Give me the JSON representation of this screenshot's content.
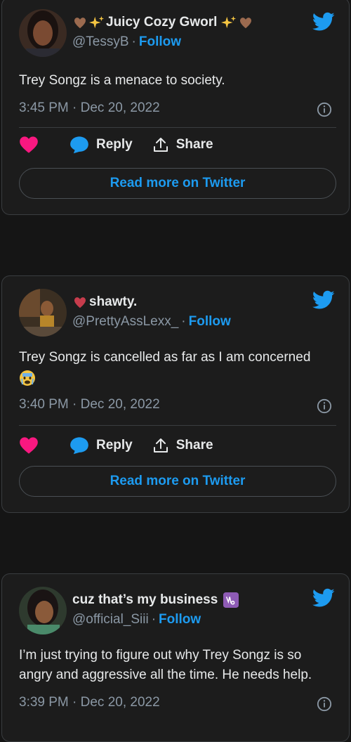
{
  "tweets": [
    {
      "display_name": "Juicy Cozy Gworl",
      "handle": "@TessyB",
      "follow_label": "Follow",
      "separator": "·",
      "text": "Trey Songz is a menace to society.",
      "time": "3:45 PM · Dec 20, 2022",
      "reply_label": "Reply",
      "share_label": "Share",
      "read_more_label": "Read more on Twitter",
      "name_emojis": [
        "brown-heart",
        "sparkles",
        "sparkles",
        "brown-heart"
      ]
    },
    {
      "display_name": "shawty.",
      "handle": "@PrettyAssLexx_",
      "follow_label": "Follow",
      "separator": "·",
      "text": "Trey Songz is cancelled as far as I am concerned",
      "text_emoji": "crying-face",
      "time": "3:40 PM · Dec 20, 2022",
      "reply_label": "Reply",
      "share_label": "Share",
      "read_more_label": "Read more on Twitter",
      "name_emojis": [
        "red-heart"
      ]
    },
    {
      "display_name": "cuz that’s my business",
      "handle": "@official_Siii",
      "follow_label": "Follow",
      "separator": "·",
      "text": "I’m just trying to figure out why Trey Songz is so angry and aggressive all the time. He needs help.",
      "time": "3:39 PM · Dec 20, 2022",
      "name_emojis": [
        "capricorn-sign"
      ]
    }
  ],
  "colors": {
    "background": "#151515",
    "card": "#1c1c1c",
    "border": "#3a3d40",
    "accent_blue": "#1d9bf0",
    "like_pink": "#f91880",
    "muted_text": "#8b98a5",
    "text": "#e7e9ea"
  },
  "icons": {
    "brand": "twitter-bird-icon",
    "like": "heart-icon",
    "reply": "speech-bubble-icon",
    "share": "share-upload-icon",
    "info": "info-icon"
  }
}
